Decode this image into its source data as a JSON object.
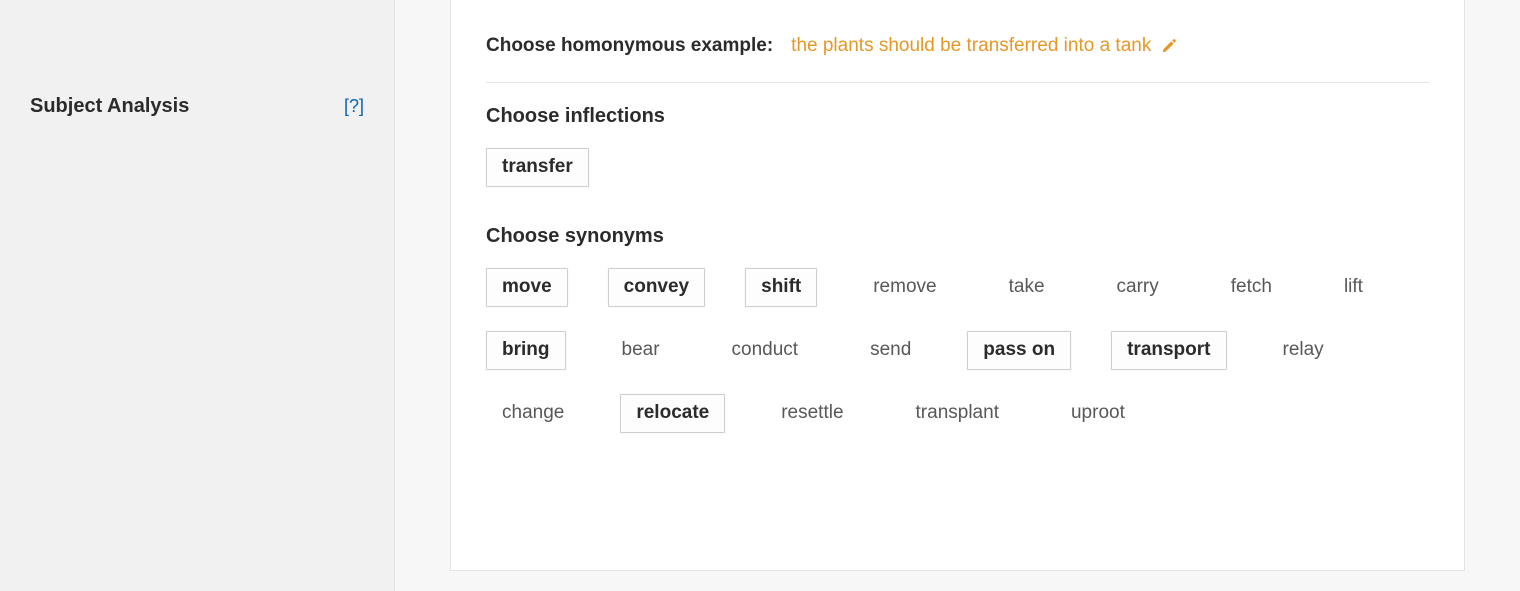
{
  "colors": {
    "accent": "#e69827",
    "link": "#0b63b7"
  },
  "sidebar": {
    "title": "Subject Analysis",
    "help_label": "[?]"
  },
  "example": {
    "label": "Choose homonymous example:",
    "value": "the plants should be transferred into a tank"
  },
  "inflections": {
    "title": "Choose inflections",
    "items": [
      {
        "label": "transfer",
        "selected": true
      }
    ]
  },
  "synonyms": {
    "title": "Choose synonyms",
    "items": [
      {
        "label": "move",
        "selected": true
      },
      {
        "label": "convey",
        "selected": true
      },
      {
        "label": "shift",
        "selected": true
      },
      {
        "label": "remove",
        "selected": false
      },
      {
        "label": "take",
        "selected": false
      },
      {
        "label": "carry",
        "selected": false
      },
      {
        "label": "fetch",
        "selected": false
      },
      {
        "label": "lift",
        "selected": false
      },
      {
        "label": "bring",
        "selected": true
      },
      {
        "label": "bear",
        "selected": false
      },
      {
        "label": "conduct",
        "selected": false
      },
      {
        "label": "send",
        "selected": false
      },
      {
        "label": "pass on",
        "selected": true
      },
      {
        "label": "transport",
        "selected": true
      },
      {
        "label": "relay",
        "selected": false
      },
      {
        "label": "change",
        "selected": false
      },
      {
        "label": "relocate",
        "selected": true
      },
      {
        "label": "resettle",
        "selected": false
      },
      {
        "label": "transplant",
        "selected": false
      },
      {
        "label": "uproot",
        "selected": false
      }
    ]
  }
}
